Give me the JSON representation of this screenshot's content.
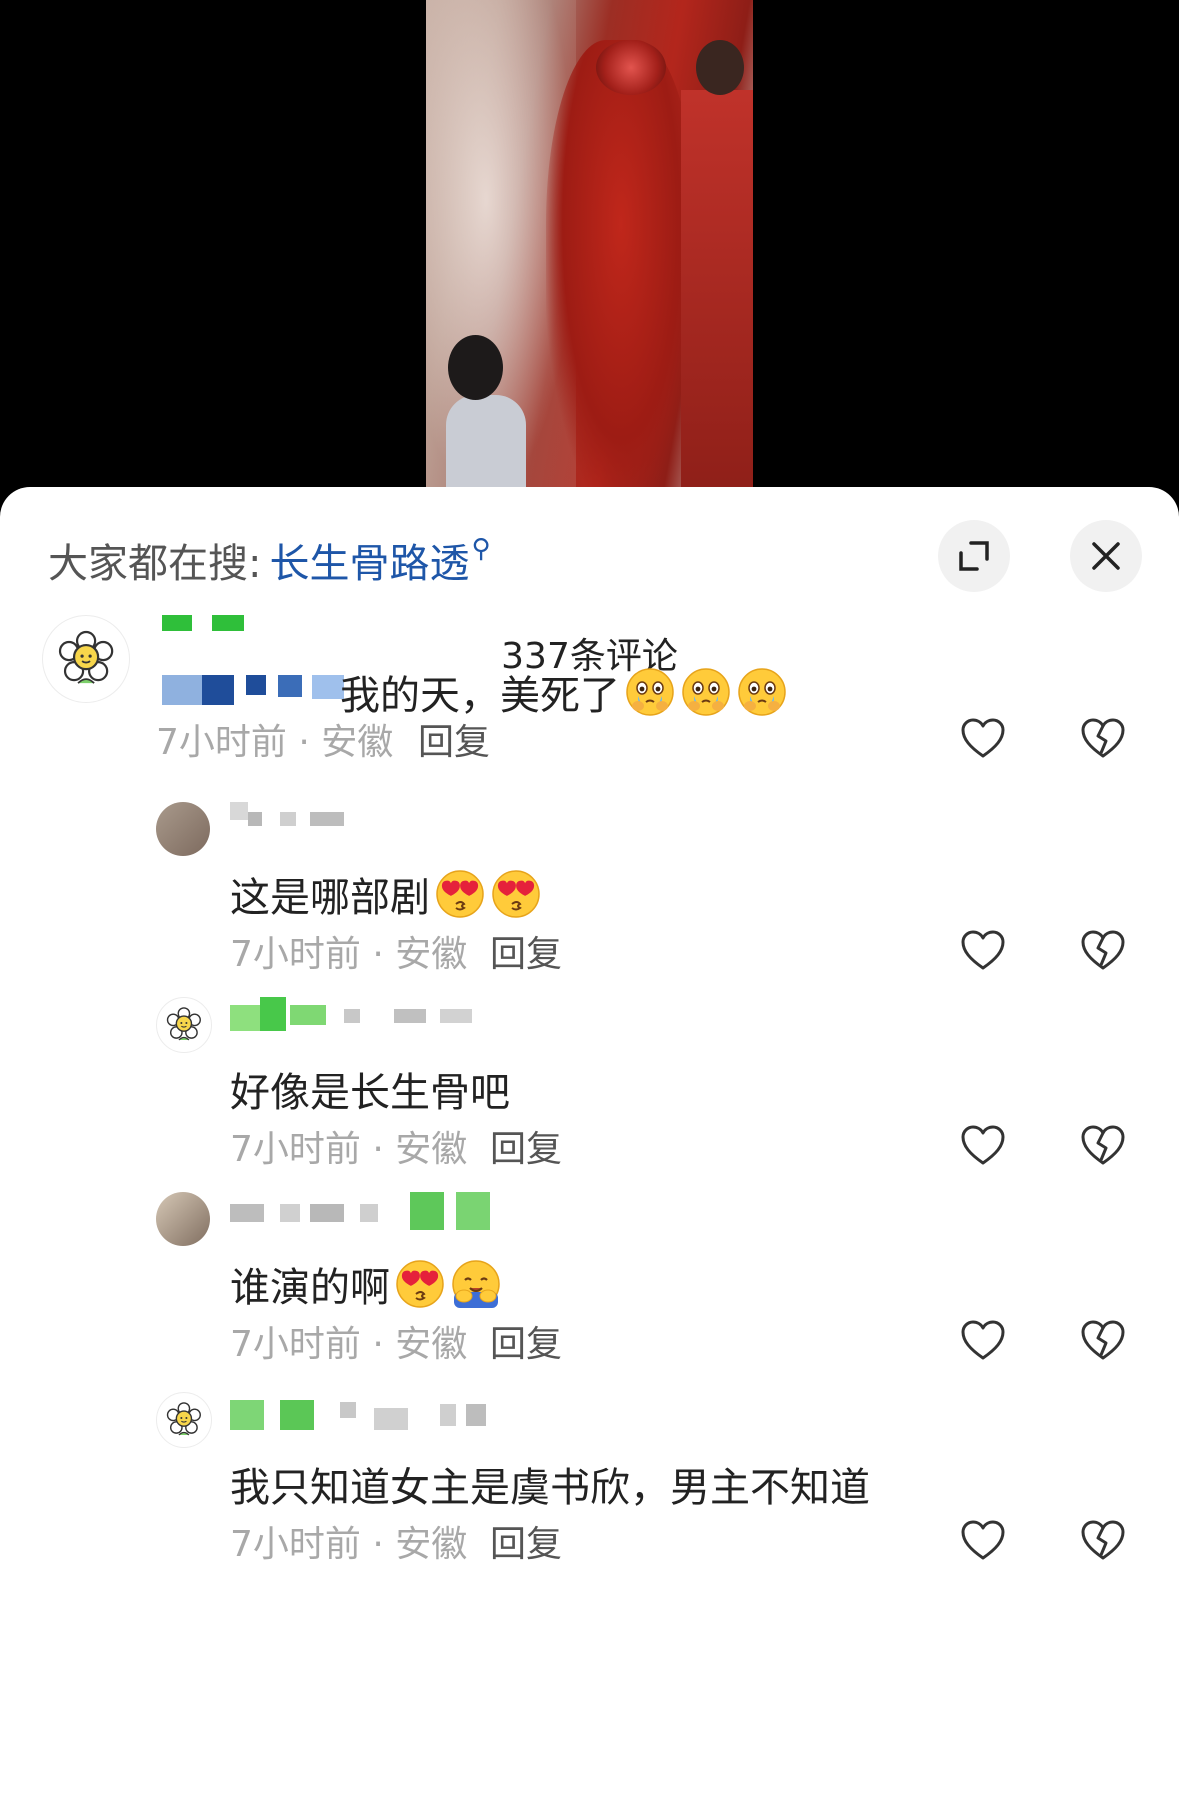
{
  "search": {
    "prefix": "大家都在搜:",
    "keyword": "长生骨路透",
    "icon": "search-icon"
  },
  "header": {
    "comment_count": "337条评论",
    "expand_icon": "expand-icon",
    "close_icon": "close-icon"
  },
  "colors": {
    "keyword": "#1e56a8",
    "meta": "#a8a8a8",
    "sheet_bg": "#ffffff"
  },
  "comments": [
    {
      "text": "我的天，美死了",
      "emojis": [
        "crying-face-emoji",
        "crying-face-emoji",
        "crying-face-emoji"
      ],
      "time": "7小时前",
      "location": "安徽",
      "reply": "回复",
      "avatar": "flower-avatar"
    },
    {
      "text": "这是哪部剧",
      "emojis": [
        "heart-eyes-emoji",
        "heart-eyes-emoji"
      ],
      "time": "7小时前",
      "location": "安徽",
      "reply": "回复",
      "avatar": "photo-avatar"
    },
    {
      "text": "好像是长生骨吧",
      "emojis": [],
      "time": "7小时前",
      "location": "安徽",
      "reply": "回复",
      "avatar": "flower-avatar"
    },
    {
      "text": "谁演的啊",
      "emojis": [
        "heart-eyes-emoji",
        "hugging-face-emoji"
      ],
      "time": "7小时前",
      "location": "安徽",
      "reply": "回复",
      "avatar": "photo-avatar"
    },
    {
      "text": "我只知道女主是虞书欣，男主不知道",
      "emojis": [],
      "time": "7小时前",
      "location": "安徽",
      "reply": "回复",
      "avatar": "flower-avatar"
    }
  ],
  "meta_separator": " · "
}
